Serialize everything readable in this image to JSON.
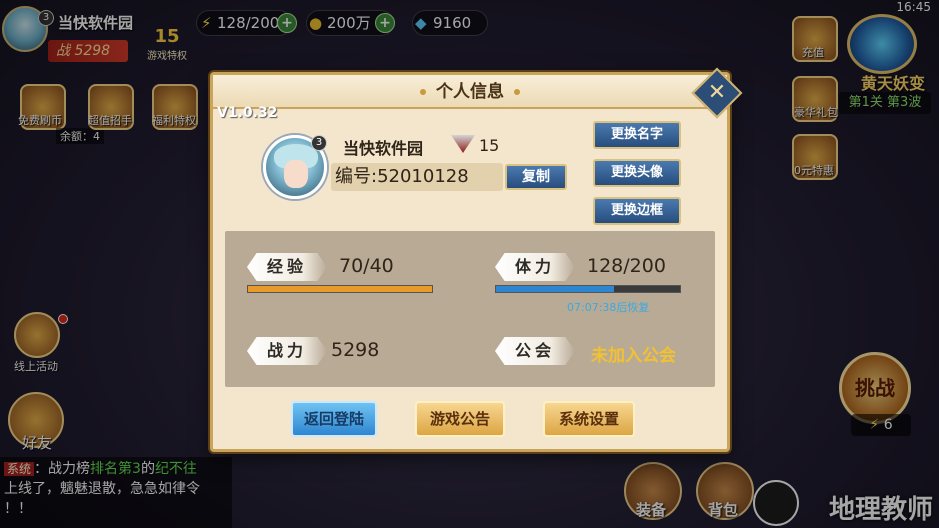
{
  "top": {
    "player_name": "当快软件园",
    "level": "3",
    "power_label": "战",
    "power_value": "5298",
    "vip_level": "15",
    "vip_label": "游戏特权",
    "stamina": "128/200",
    "gold": "200万",
    "gems": "9160",
    "time": "16:45"
  },
  "left_icons": {
    "free_refresh_label": "免费刷币",
    "remaining_label": "余额：4",
    "recruit_label": "超值招手",
    "welfare_label": "福利特权",
    "online_event_label": "线上活动",
    "hero_label": "好友"
  },
  "right_icons": {
    "recharge_label": "充值",
    "gift_label": "豪华礼包",
    "event_label": "0元特惠",
    "boss_name": "黄天妖变",
    "stage_text": "第1关 第3波",
    "challenge_label": "挑战",
    "energy_count": "6"
  },
  "chat": {
    "tag": "系统",
    "line1_prefix": "：战力榜",
    "line1_highlight": "排名第3",
    "line1_suffix": "的",
    "line1_name": "纪不往",
    "line2": "上线了，魑魅退散，急急如律令",
    "line3": "！！"
  },
  "bottom_nav": {
    "equip_label": "装备",
    "bag_label": "背包"
  },
  "watermark": "地理教师",
  "dialog": {
    "title": "个人信息",
    "version": "V1.0.32",
    "close_icon": "close-x-icon",
    "player_name": "当快软件园",
    "level": "3",
    "rank_level": "15",
    "id_text": "编号:52010128",
    "copy_label": "复制",
    "change_name_label": "更换名字",
    "change_avatar_label": "更换头像",
    "change_frame_label": "更换边框",
    "exp_label": "经验",
    "exp_value": "70/40",
    "exp_fill": 1.0,
    "stamina_label": "体力",
    "stamina_value": "128/200",
    "stamina_fill": 0.64,
    "stamina_timer": "07:07:38后恢复",
    "power_label": "战力",
    "power_value": "5298",
    "guild_label": "公会",
    "guild_value": "未加入公会",
    "back_login_label": "返回登陆",
    "announcement_label": "游戏公告",
    "settings_label": "系统设置"
  },
  "colors": {
    "exp_bar": "#e89a2a",
    "stamina_bar": "#2f86d0",
    "guild_text": "#f2c230",
    "dialog_bg": "#f3e6cc"
  }
}
